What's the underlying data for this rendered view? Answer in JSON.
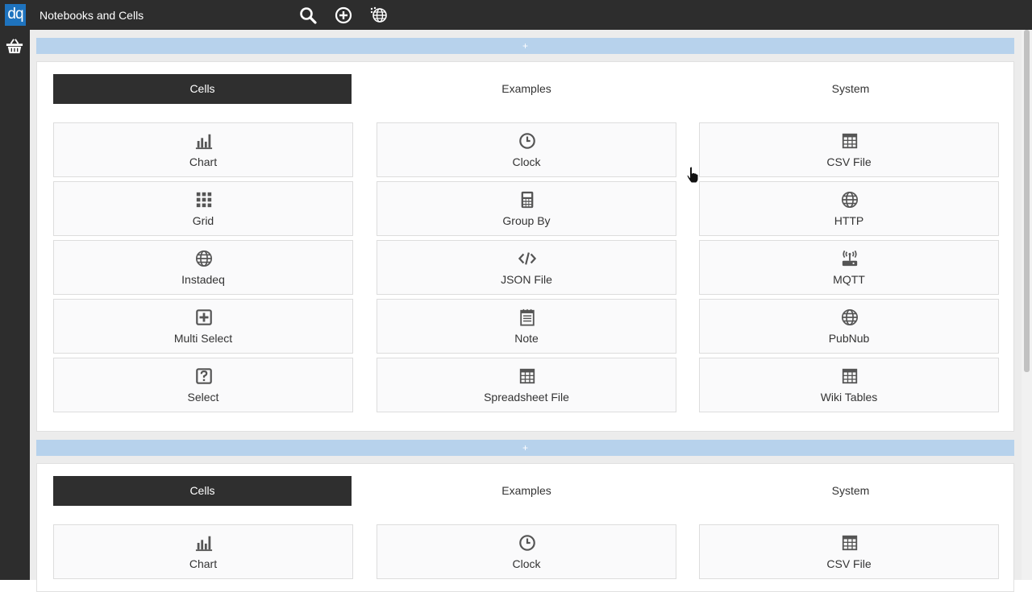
{
  "topbar": {
    "logo": "dq",
    "title": "Notebooks and Cells",
    "icons": [
      "search-icon",
      "add-circle-icon",
      "globe-network-icon"
    ]
  },
  "sidebar": {
    "icons": [
      "basket-icon"
    ]
  },
  "add_strip": {
    "label": "+"
  },
  "panels": [
    {
      "tabs": [
        {
          "label": "Cells",
          "active": true
        },
        {
          "label": "Examples",
          "active": false
        },
        {
          "label": "System",
          "active": false
        }
      ],
      "columns": [
        [
          {
            "label": "Chart",
            "icon": "bar-chart-icon"
          },
          {
            "label": "Grid",
            "icon": "grid-icon"
          },
          {
            "label": "Instadeq",
            "icon": "globe-icon"
          },
          {
            "label": "Multi Select",
            "icon": "plus-square-icon"
          },
          {
            "label": "Select",
            "icon": "question-square-icon"
          }
        ],
        [
          {
            "label": "Clock",
            "icon": "clock-icon"
          },
          {
            "label": "Group By",
            "icon": "calculator-icon"
          },
          {
            "label": "JSON File",
            "icon": "code-icon"
          },
          {
            "label": "Note",
            "icon": "notepad-icon"
          },
          {
            "label": "Spreadsheet File",
            "icon": "table-icon"
          }
        ],
        [
          {
            "label": "CSV File",
            "icon": "table-icon"
          },
          {
            "label": "HTTP",
            "icon": "globe-icon"
          },
          {
            "label": "MQTT",
            "icon": "router-icon"
          },
          {
            "label": "PubNub",
            "icon": "globe-icon"
          },
          {
            "label": "Wiki Tables",
            "icon": "table-icon"
          }
        ]
      ]
    },
    {
      "tabs": [
        {
          "label": "Cells",
          "active": true
        },
        {
          "label": "Examples",
          "active": false
        },
        {
          "label": "System",
          "active": false
        }
      ],
      "columns": [
        [
          {
            "label": "Chart",
            "icon": "bar-chart-icon"
          }
        ],
        [
          {
            "label": "Clock",
            "icon": "clock-icon"
          }
        ],
        [
          {
            "label": "CSV File",
            "icon": "table-icon"
          }
        ]
      ]
    }
  ],
  "colors": {
    "accent": "#1e73be",
    "topbar": "#2d2d2d",
    "strip": "#b7d2ec",
    "icon": "#555555"
  }
}
